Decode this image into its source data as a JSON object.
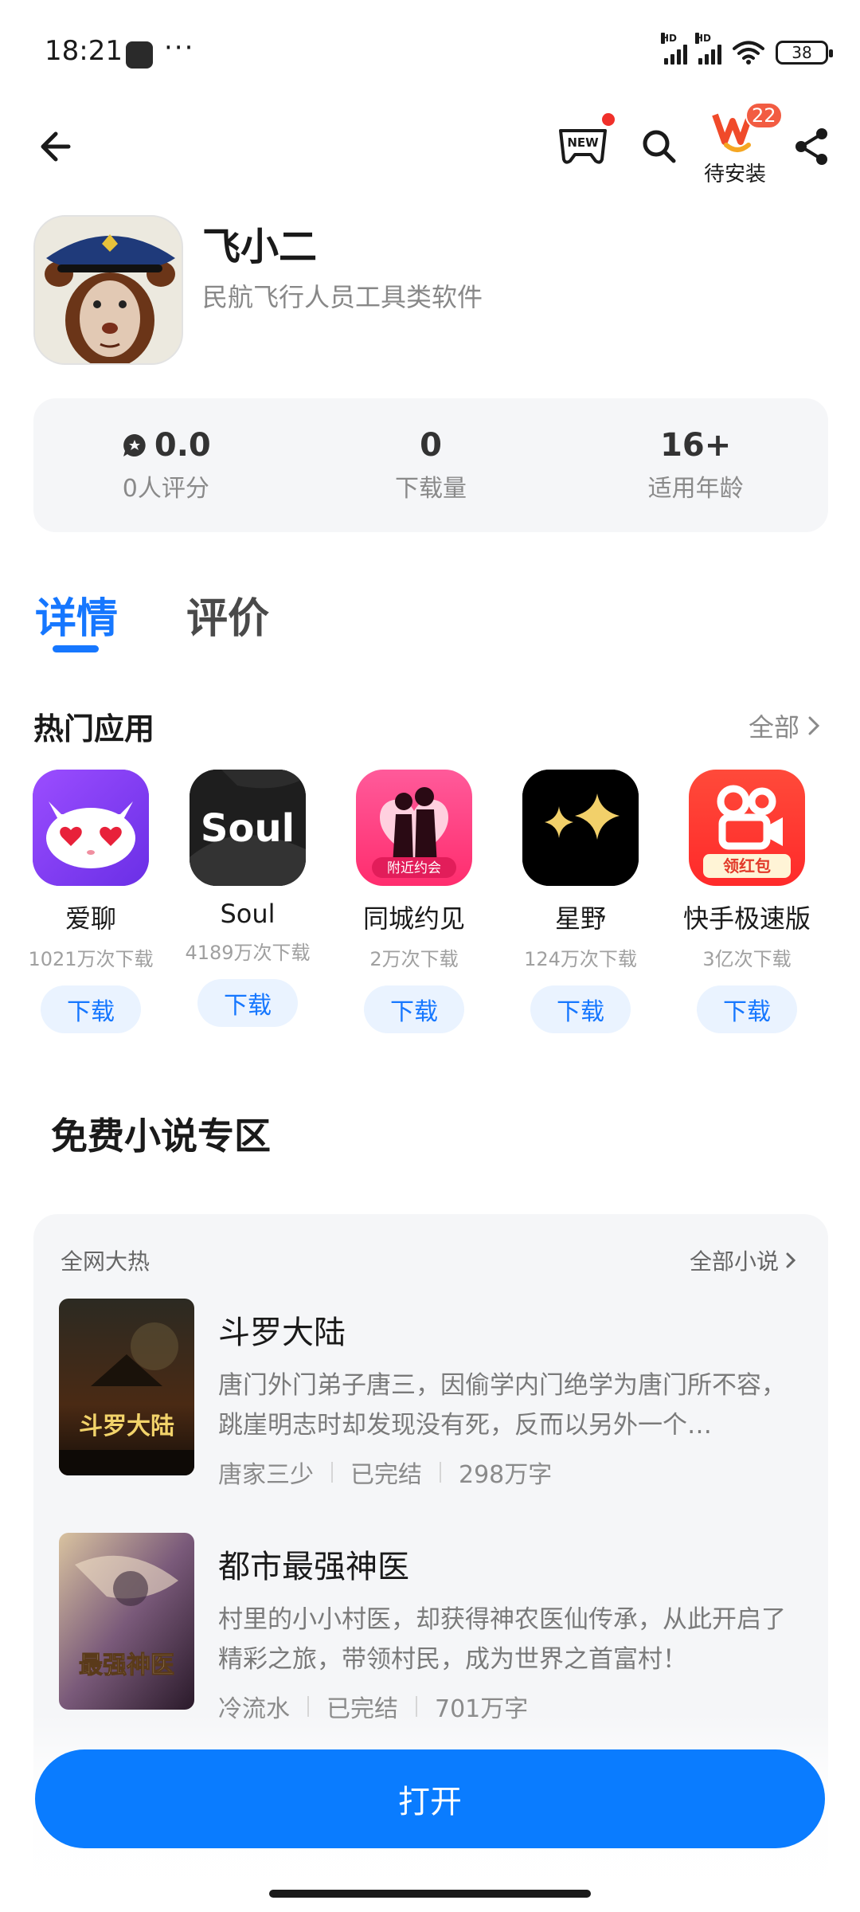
{
  "status_bar": {
    "time": "18:21",
    "more": "···",
    "hd1": "HD",
    "hd2": "HD",
    "battery": "38",
    "icons": [
      "notification-app-icon",
      "signal-icon",
      "signal-icon",
      "wifi-icon",
      "battery-icon"
    ]
  },
  "topbar": {
    "icons": [
      "back-arrow-icon",
      "new-game-controller-icon",
      "search-icon",
      "app-store-logo-icon",
      "share-icon"
    ],
    "new_label": "NEW",
    "pending_badge": "22",
    "pending_label": "待安装"
  },
  "app": {
    "name": "飞小二",
    "subtitle": "民航飞行人员工具类软件"
  },
  "stats": {
    "rating_value": "0.0",
    "rating_label": "0人评分",
    "downloads_value": "0",
    "downloads_label": "下载量",
    "age_value": "16+",
    "age_label": "适用年龄"
  },
  "tabs": {
    "detail": "详情",
    "reviews": "评价"
  },
  "hot_apps": {
    "title": "热门应用",
    "see_all": "全部",
    "download_label": "下载",
    "items": [
      {
        "name": "爱聊",
        "downloads": "1021万次下载"
      },
      {
        "name": "Soul",
        "downloads": "4189万次下载",
        "icon_text": "Soul"
      },
      {
        "name": "同城约见",
        "downloads": "2万次下载",
        "icon_text": "附近约会"
      },
      {
        "name": "星野",
        "downloads": "124万次下载"
      },
      {
        "name": "快手极速版",
        "downloads": "3亿次下载",
        "icon_text": "领红包"
      }
    ]
  },
  "novels": {
    "section_title": "免费小说专区",
    "tag": "全网大热",
    "see_all": "全部小说",
    "items": [
      {
        "title": "斗罗大陆",
        "desc": "唐门外门弟子唐三，因偷学内门绝学为唐门所不容，跳崖明志时却发现没有死，反而以另外一个…",
        "author": "唐家三少",
        "status": "已完结",
        "words": "298万字",
        "cover_text": "斗罗大陆"
      },
      {
        "title": "都市最强神医",
        "desc": "村里的小小村医，却获得神农医仙传承，从此开启了精彩之旅，带领村民，成为世界之首富村！",
        "author": "冷流水",
        "status": "已完结",
        "words": "701万字",
        "cover_text": "最强神医"
      }
    ]
  },
  "open_button": "打开",
  "colors": {
    "accent": "#1677ff",
    "open_button": "#0a7cff",
    "badge": "#f25c42"
  }
}
